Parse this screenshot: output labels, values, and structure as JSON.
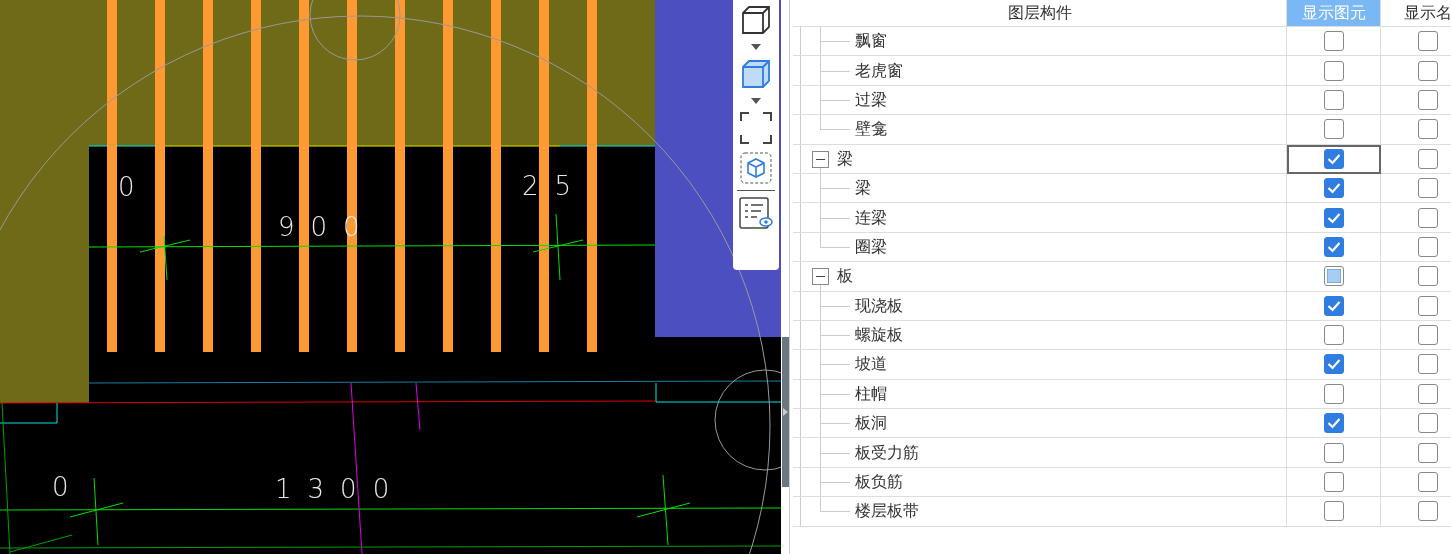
{
  "canvas": {
    "dimension_labels": [
      {
        "text": "0"
      },
      {
        "text": "25"
      },
      {
        "text": "900"
      },
      {
        "text": "0"
      },
      {
        "text": "1300"
      }
    ]
  },
  "layer_panel": {
    "columns": [
      {
        "label": "图层构件",
        "selected": false
      },
      {
        "label": "显示图元",
        "selected": true
      },
      {
        "label": "显示名",
        "selected": false
      }
    ],
    "layers": [
      {
        "children": [
          {
            "label": "飘窗",
            "show_element": false,
            "show_name": false,
            "focused": false
          },
          {
            "label": "老虎窗",
            "show_element": false,
            "show_name": false,
            "focused": false
          },
          {
            "label": "过梁",
            "show_element": false,
            "show_name": false,
            "focused": false
          },
          {
            "label": "壁龛",
            "show_element": false,
            "show_name": false,
            "focused": false
          }
        ]
      },
      {
        "label": "梁",
        "expanded": true,
        "show_element": true,
        "show_name": false,
        "focused": true,
        "children": [
          {
            "label": "梁",
            "show_element": true,
            "show_name": false,
            "focused": false
          },
          {
            "label": "连梁",
            "show_element": true,
            "show_name": false,
            "focused": false
          },
          {
            "label": "圈梁",
            "show_element": true,
            "show_name": false,
            "focused": false
          }
        ]
      },
      {
        "label": "板",
        "expanded": true,
        "show_element": false,
        "show_element_mixed": true,
        "show_name": false,
        "focused": false,
        "children": [
          {
            "label": "现浇板",
            "show_element": true,
            "show_name": false,
            "focused": false
          },
          {
            "label": "螺旋板",
            "show_element": false,
            "show_name": false,
            "focused": false
          },
          {
            "label": "坡道",
            "show_element": true,
            "show_name": false,
            "focused": false
          },
          {
            "label": "柱帽",
            "show_element": false,
            "show_name": false,
            "focused": false
          },
          {
            "label": "板洞",
            "show_element": true,
            "show_name": false,
            "focused": false
          },
          {
            "label": "板受力筋",
            "show_element": false,
            "show_name": false,
            "focused": false
          },
          {
            "label": "板负筋",
            "show_element": false,
            "show_name": false,
            "focused": false
          },
          {
            "label": "楼层板带",
            "show_element": false,
            "show_name": false,
            "focused": false
          }
        ]
      }
    ]
  }
}
